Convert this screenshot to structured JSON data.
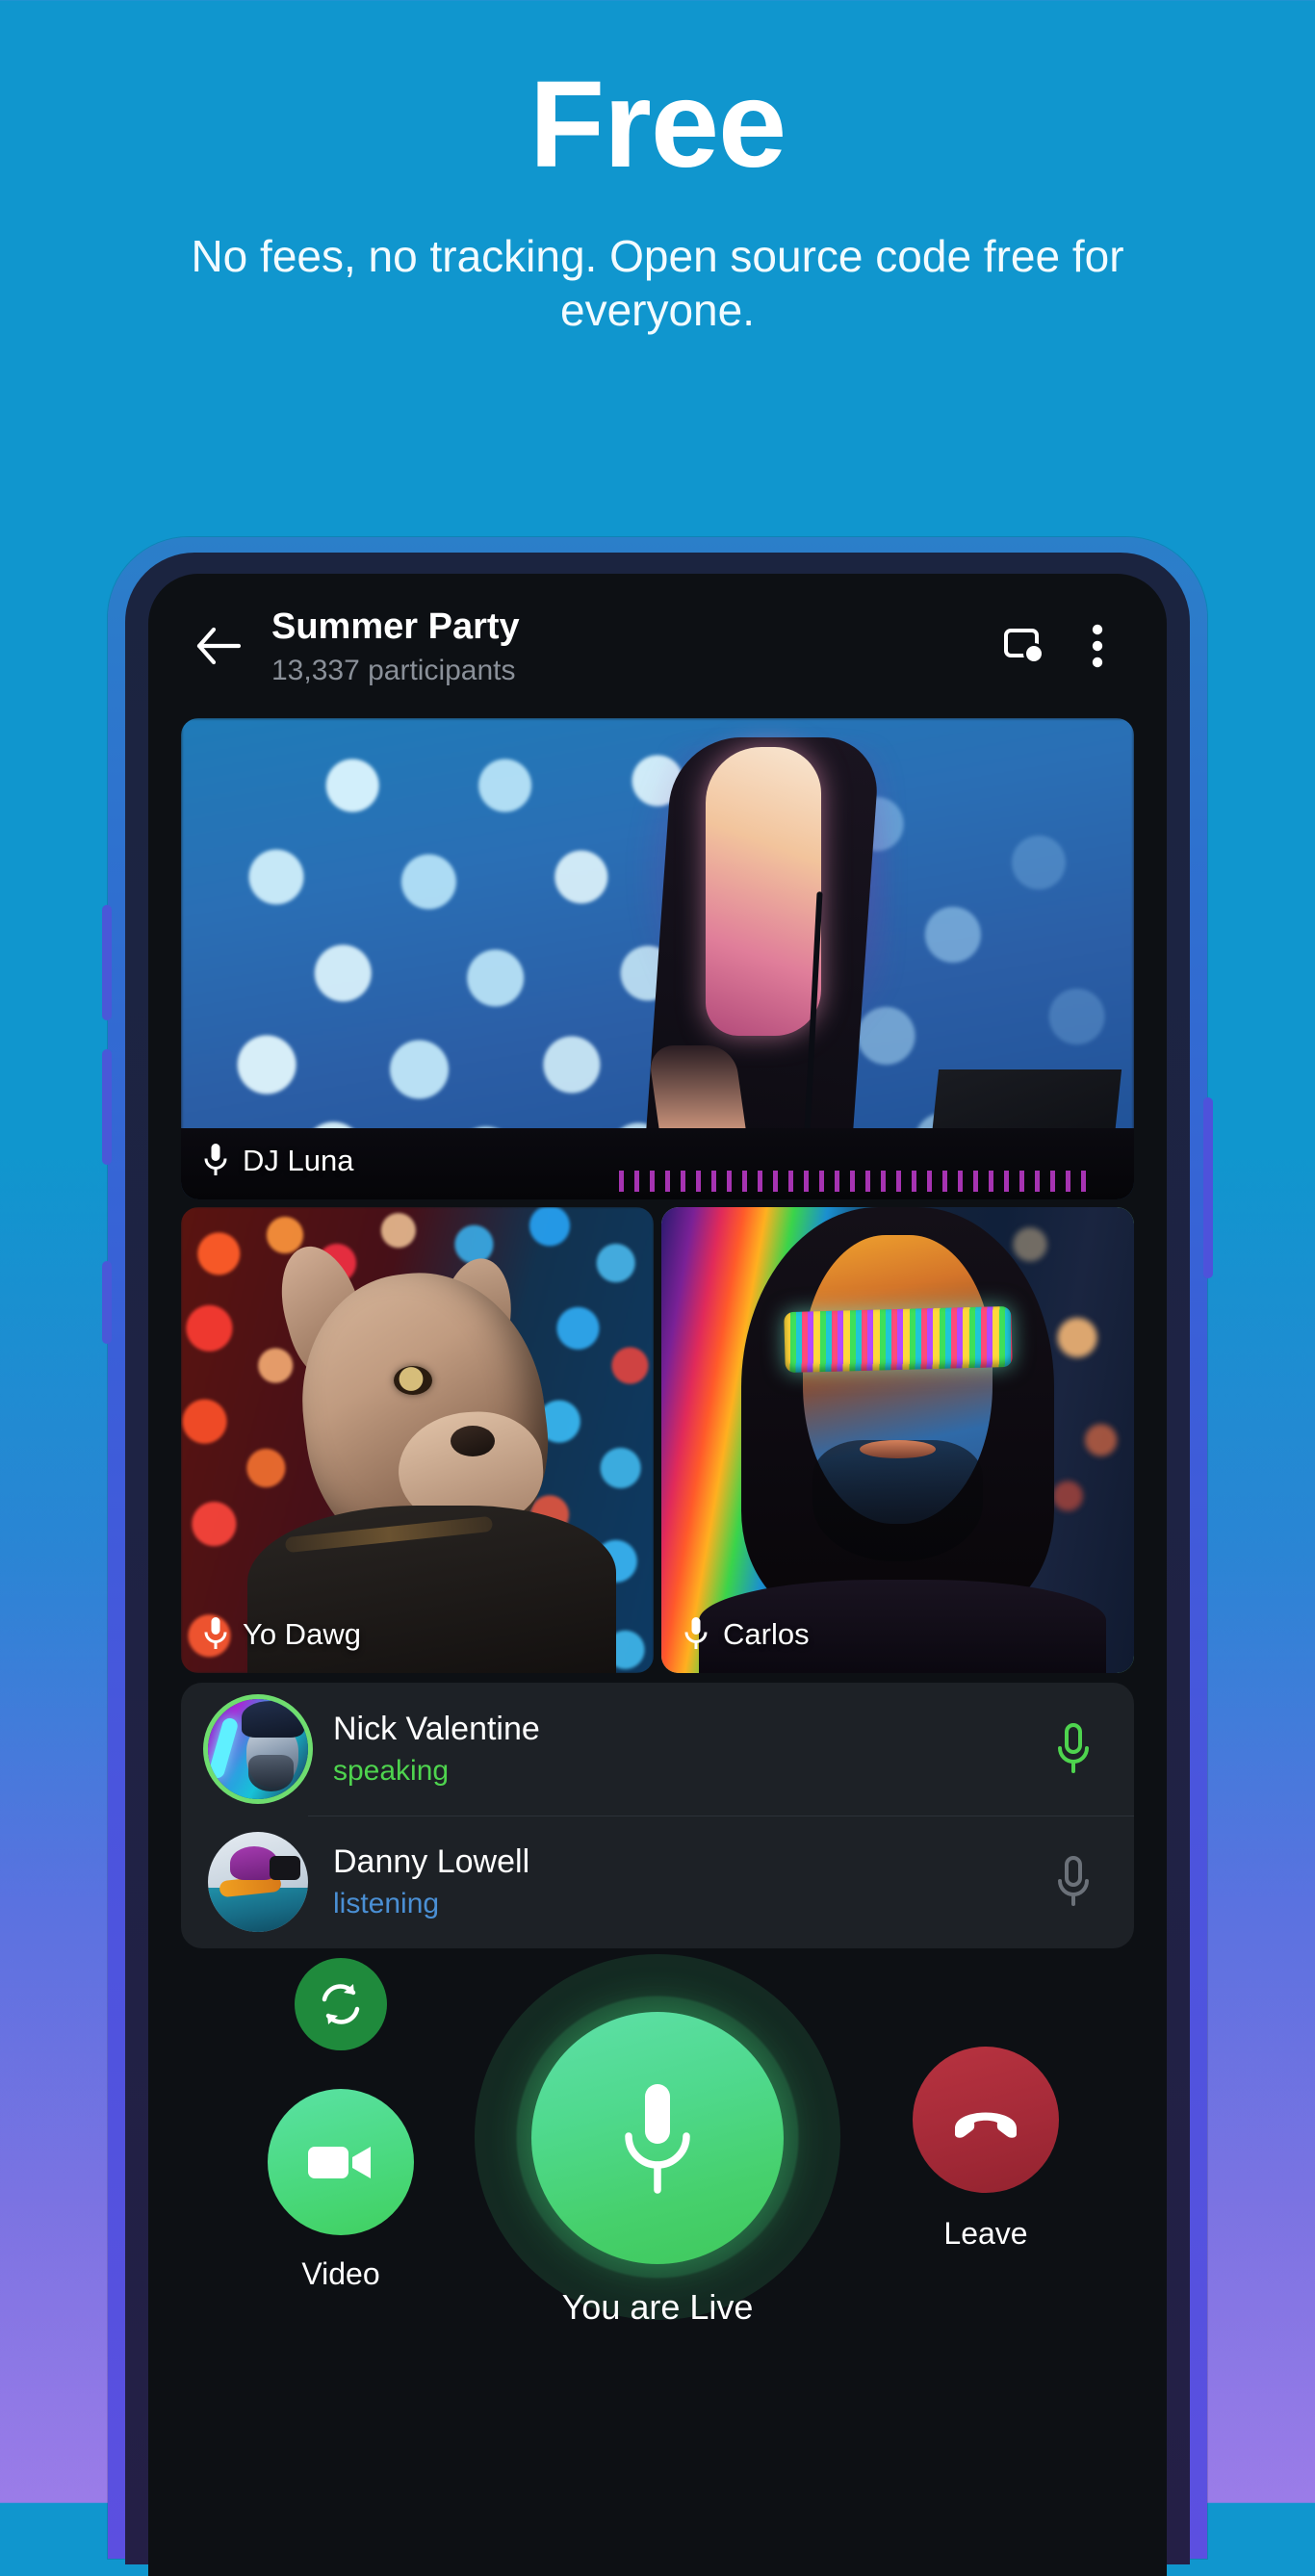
{
  "promo": {
    "title": "Free",
    "subtitle": "No fees, no tracking. Open source code free for everyone."
  },
  "colors": {
    "background_top": "#1096ce",
    "background_bottom": "#9b7ce8",
    "phone_bezel_top": "#2b7fc9",
    "phone_bezel_bottom": "#5c4fe0",
    "screen_background": "#0d1014",
    "accent_green": "#4ed44e",
    "speaking_green": "#7ee787",
    "listening_blue": "#4a8fd4",
    "leave_red": "#a52a38",
    "mic_button_green": "#46d06c",
    "panel_background": "#1d2126",
    "subtitle_gray": "#8a9099"
  },
  "app": {
    "header": {
      "back_icon": "arrow-left-icon",
      "title": "Summer Party",
      "subtitle": "13,337 participants",
      "screen_share_icon": "screen-share-icon",
      "more_icon": "more-vertical-icon"
    },
    "video_tiles": [
      {
        "name": "DJ Luna",
        "mic_icon": "microphone-icon",
        "active_speaker": false,
        "size": "large"
      },
      {
        "name": "Yo Dawg",
        "mic_icon": "microphone-icon",
        "active_speaker": false,
        "size": "half"
      },
      {
        "name": "Carlos",
        "mic_icon": "microphone-icon",
        "active_speaker": true,
        "size": "half"
      }
    ],
    "participants": [
      {
        "name": "Nick Valentine",
        "status": "speaking",
        "status_state": "speaking",
        "mic_icon": "microphone-icon",
        "mic_state": "on"
      },
      {
        "name": "Danny Lowell",
        "status": "listening",
        "status_state": "listening",
        "mic_icon": "microphone-icon",
        "mic_state": "off"
      }
    ],
    "controls": {
      "flip_camera": {
        "icon": "flip-camera-icon",
        "label": ""
      },
      "video": {
        "icon": "video-camera-icon",
        "label": "Video"
      },
      "microphone": {
        "icon": "microphone-icon",
        "label": "You are Live"
      },
      "leave": {
        "icon": "hang-up-icon",
        "label": "Leave"
      }
    }
  }
}
